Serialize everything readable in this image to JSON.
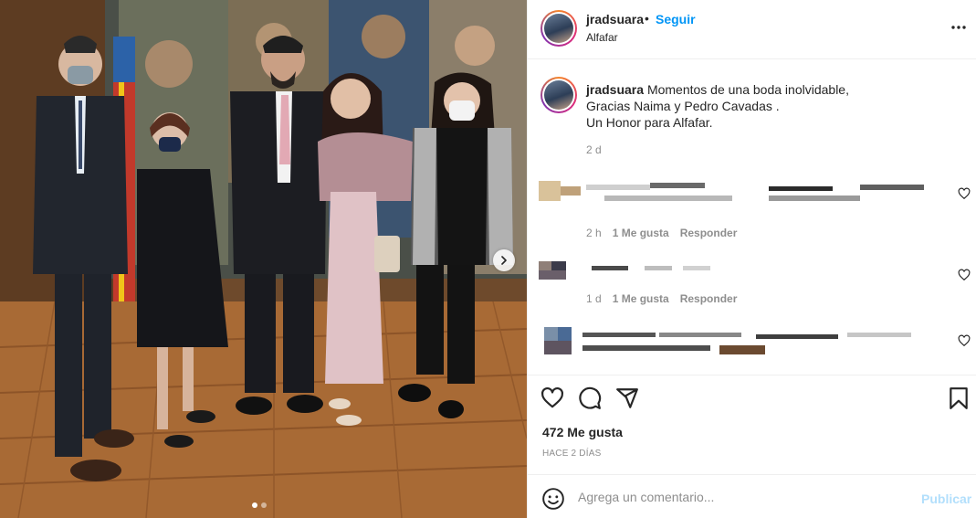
{
  "post": {
    "username": "jradsuara",
    "separator": "•",
    "follow_label": "Seguir",
    "location": "Alfafar",
    "caption_user": "jradsuara",
    "caption_lines": [
      "Momentos de una boda inolvidable,",
      "Gracias Naima y Pedro Cavadas .",
      "Un Honor para Alfafar."
    ],
    "caption_time": "2 d",
    "likes": "472 Me gusta",
    "posted_ago": "HACE 2 DÍAS"
  },
  "comments": [
    {
      "time": "2 h",
      "likes": "1 Me gusta",
      "reply": "Responder"
    },
    {
      "time": "",
      "likes": "",
      "reply": ""
    },
    {
      "time": "1 d",
      "likes": "1 Me gusta",
      "reply": "Responder"
    }
  ],
  "add_comment": {
    "placeholder": "Agrega un comentario...",
    "publish_label": "Publicar"
  },
  "colors": {
    "accent": "#0095f6",
    "publish_disabled": "#b2dffc",
    "muted": "#8e8e8e",
    "text": "#262626"
  },
  "icons": [
    "more-options-icon",
    "heart-icon",
    "comment-icon",
    "share-icon",
    "bookmark-icon",
    "emoji-icon",
    "next-arrow-icon"
  ],
  "carousel": {
    "count": 2,
    "current": 1
  }
}
